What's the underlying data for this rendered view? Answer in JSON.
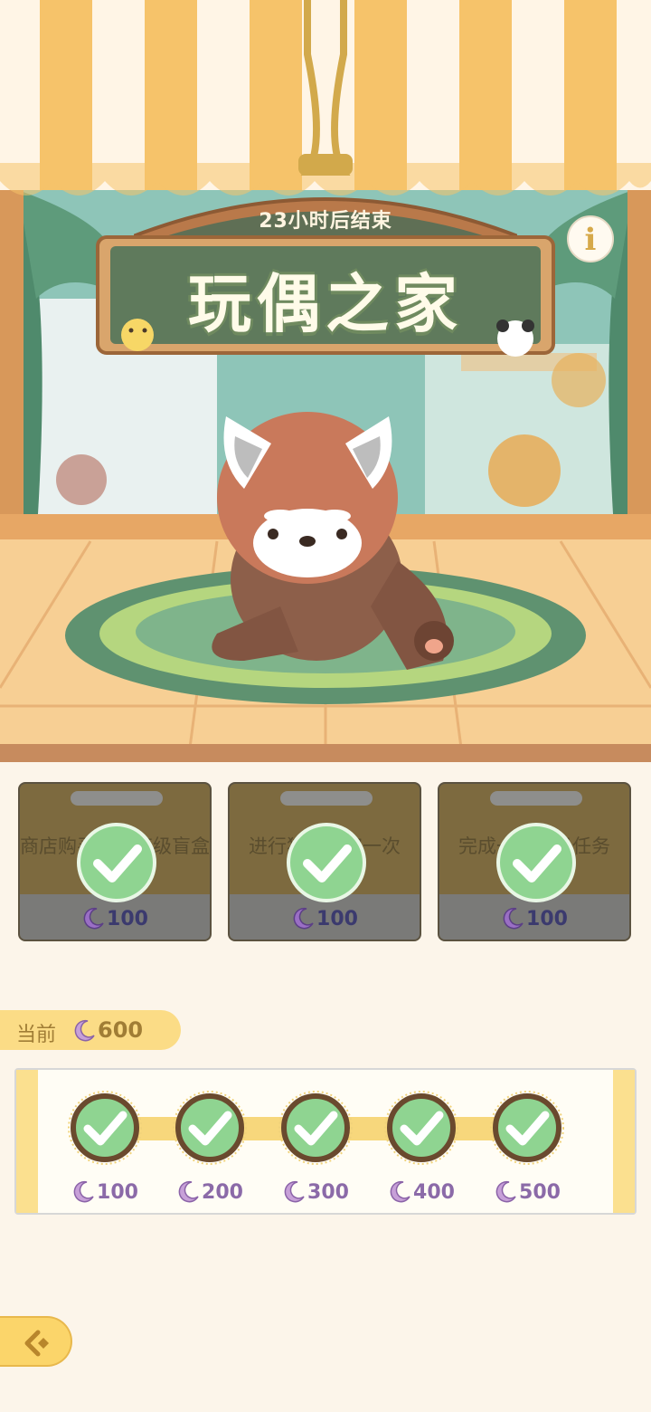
{
  "sign": {
    "timer": "23小时后结束",
    "title": "玩偶之家"
  },
  "info_button": {
    "label": "i"
  },
  "tasks": [
    {
      "text": "商店购买一次高级盲盒兑换券",
      "reward": "100",
      "completed": true
    },
    {
      "text": "进行猫力领取一次",
      "reward": "100",
      "completed": true
    },
    {
      "text": "完成一次每日任务",
      "reward": "100",
      "completed": true
    }
  ],
  "current": {
    "label": "当前",
    "value": "600"
  },
  "milestones": [
    {
      "reward": "100",
      "completed": true
    },
    {
      "reward": "200",
      "completed": true
    },
    {
      "reward": "300",
      "completed": true
    },
    {
      "reward": "400",
      "completed": true
    },
    {
      "reward": "500",
      "completed": true
    }
  ],
  "colors": {
    "accent": "#fbd56a",
    "moon": "#9a6fc4",
    "check": "#8fd491"
  },
  "icons": {
    "currency": "moon-icon",
    "done": "checkmark-icon",
    "back": "back-arrow-icon",
    "info": "info-icon"
  }
}
